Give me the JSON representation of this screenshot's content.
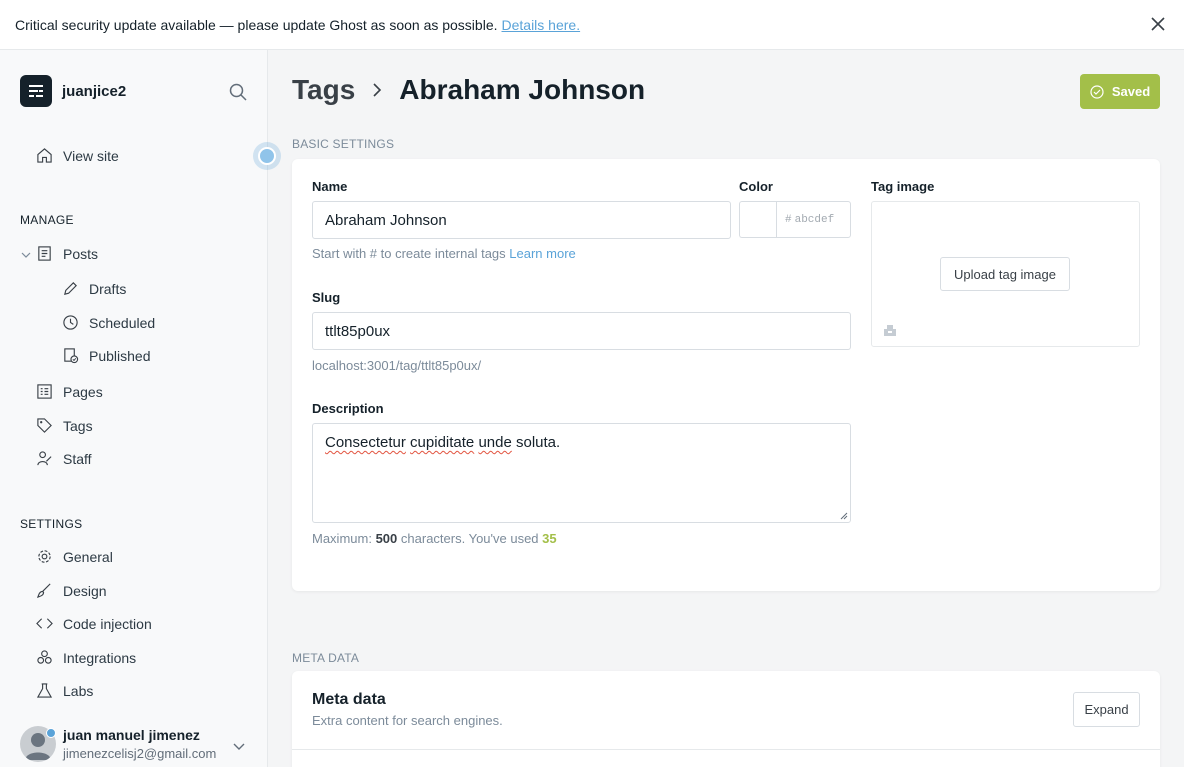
{
  "banner": {
    "message": "Critical security update available — please update Ghost as soon as possible.",
    "link": "Details here."
  },
  "sidebar": {
    "site_name": "juanjice2",
    "view_site": "View site",
    "manage_title": "MANAGE",
    "posts": "Posts",
    "drafts": "Drafts",
    "scheduled": "Scheduled",
    "published": "Published",
    "pages": "Pages",
    "tags": "Tags",
    "staff": "Staff",
    "settings_title": "SETTINGS",
    "general": "General",
    "design": "Design",
    "code_injection": "Code injection",
    "integrations": "Integrations",
    "labs": "Labs"
  },
  "user": {
    "name": "juan manuel jimenez",
    "email": "jimenezcelisj2@gmail.com"
  },
  "header": {
    "crumb_parent": "Tags",
    "crumb_current": "Abraham Johnson",
    "saved_label": "Saved"
  },
  "basic": {
    "section_label": "BASIC SETTINGS",
    "name_label": "Name",
    "name_value": "Abraham Johnson",
    "name_hint": "Start with # to create internal tags",
    "learn_more": "Learn more",
    "color_label": "Color",
    "color_placeholder": "abcdef",
    "color_hash": "#",
    "image_label": "Tag image",
    "upload_label": "Upload tag image",
    "slug_label": "Slug",
    "slug_value": "ttlt85p0ux",
    "slug_url": "localhost:3001/tag/ttlt85p0ux/",
    "description_label": "Description",
    "description_words": [
      "Consectetur",
      "cupiditate",
      "unde",
      "soluta."
    ],
    "count_prefix": "Maximum:",
    "count_max": "500",
    "count_middle": "characters. You've used",
    "count_used": "35"
  },
  "meta": {
    "section_label": "META DATA",
    "title": "Meta data",
    "subtitle": "Extra content for search engines.",
    "expand_label": "Expand"
  },
  "colors": {
    "accent_green": "#a3bf49",
    "link_blue": "#5aa3d8",
    "text_dark": "#15212a"
  }
}
